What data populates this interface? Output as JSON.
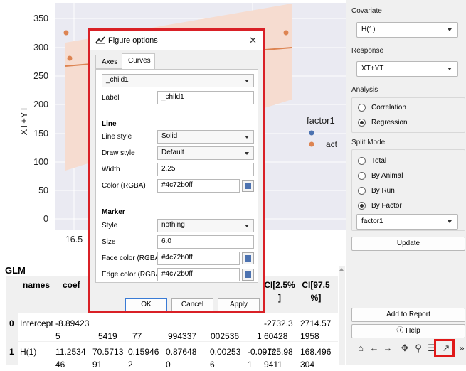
{
  "plot": {
    "ylabel": "XT+YT",
    "y_ticks": [
      "350",
      "300",
      "250",
      "200",
      "150",
      "100",
      "50",
      "0"
    ],
    "x_tick": "16.5",
    "legend_title": "factor1",
    "legend_entry": "act",
    "colors": {
      "blue": "#4c72b0",
      "orange": "#dd8452",
      "band": "#f6dcd0"
    }
  },
  "glm": {
    "title": "GLM",
    "headers": [
      "names",
      "coef",
      "CI[2.5%\n]",
      "CI[97.5\n%]"
    ],
    "rows": [
      {
        "index": "0",
        "name": "Intercept",
        "coef": "-8.894235",
        "c3": "5419",
        "c4": "77",
        "c5": "994337",
        "c6": "002536",
        "c7": "1",
        "ci_low": "-2732.360428",
        "ci_high": "2714.571958"
      },
      {
        "index": "1",
        "name": "H(1)",
        "coef": "11.253446",
        "c3": "70.571391",
        "c4": "0.159462",
        "c5": "0.876480",
        "c6": "0.002536",
        "c7": "-0.09721",
        "ci_low": "-145.989411",
        "ci_high": "168.496304"
      }
    ]
  },
  "panel": {
    "covariate_label": "Covariate",
    "covariate_value": "H(1)",
    "response_label": "Response",
    "response_value": "XT+YT",
    "analysis_label": "Analysis",
    "analysis_options": [
      "Correlation",
      "Regression"
    ],
    "split_label": "Split Mode",
    "split_options": [
      "Total",
      "By Animal",
      "By Run",
      "By Factor"
    ],
    "factor_value": "factor1",
    "update": "Update",
    "add_report": "Add to Report",
    "help": "Help"
  },
  "dialog": {
    "title": "Figure options",
    "tabs": [
      "Axes",
      "Curves"
    ],
    "curve_select": "_child1",
    "label_label": "Label",
    "label_value": "_child1",
    "line_head": "Line",
    "line_style_label": "Line style",
    "line_style_value": "Solid",
    "draw_style_label": "Draw style",
    "draw_style_value": "Default",
    "width_label": "Width",
    "width_value": "2.25",
    "color_label": "Color (RGBA)",
    "color_value": "#4c72b0ff",
    "marker_head": "Marker",
    "style_label": "Style",
    "style_value": "nothing",
    "size_label": "Size",
    "size_value": "6.0",
    "face_label": "Face color (RGBA)",
    "face_value": "#4c72b0ff",
    "edge_label": "Edge color (RGBA)",
    "edge_value": "#4c72b0ff",
    "swatch_color": "#4c72b0",
    "ok": "OK",
    "cancel": "Cancel",
    "apply": "Apply"
  }
}
